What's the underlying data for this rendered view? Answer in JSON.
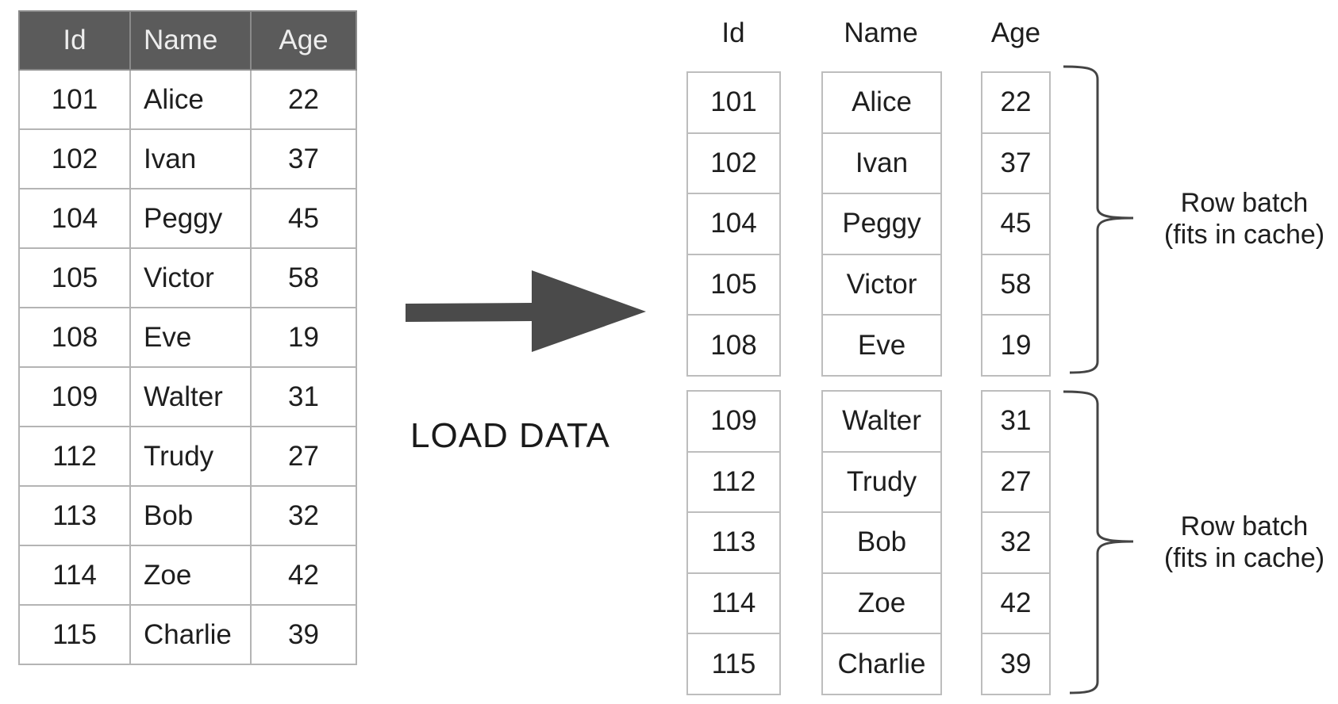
{
  "columns": [
    "Id",
    "Name",
    "Age"
  ],
  "rows": [
    [
      "101",
      "Alice",
      "22"
    ],
    [
      "102",
      "Ivan",
      "37"
    ],
    [
      "104",
      "Peggy",
      "45"
    ],
    [
      "105",
      "Victor",
      "58"
    ],
    [
      "108",
      "Eve",
      "19"
    ],
    [
      "109",
      "Walter",
      "31"
    ],
    [
      "112",
      "Trudy",
      "27"
    ],
    [
      "113",
      "Bob",
      "32"
    ],
    [
      "114",
      "Zoe",
      "42"
    ],
    [
      "115",
      "Charlie",
      "39"
    ]
  ],
  "arrow_label": "LOAD DATA",
  "batches": [
    {
      "label_line1": "Row batch",
      "label_line2": "(fits in cache)"
    },
    {
      "label_line1": "Row batch",
      "label_line2": "(fits in cache)"
    }
  ],
  "colors": {
    "header_bg": "#5b5b5b",
    "arrow": "#4a4a4a",
    "border": "#b4b4b4"
  }
}
